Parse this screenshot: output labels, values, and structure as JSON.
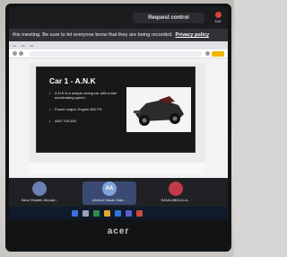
{
  "meeting": {
    "request_control_label": "Request control",
    "exit_label": "Exit",
    "recording_notice": "this meeting. Be sure to let everyone know that they are being recorded.",
    "privacy_link": "Privacy policy"
  },
  "slide": {
    "title": "Car 1 - A.N.K",
    "bullets": [
      "A.N.K is a unique racing car with a fast accelerating speed.",
      "Power output: Engine 800 PS",
      "AED 700,000"
    ]
  },
  "participants": [
    {
      "name": "Sara Ghadeir Ahmad..."
    },
    {
      "name": "Ahmed Hasan Sale...",
      "initials": "AA"
    },
    {
      "name": "SANA ABDULLA..."
    }
  ],
  "laptop_brand": "acer",
  "colors": {
    "slide_background": "#17181a",
    "meeting_bar": "#303236",
    "exit_button": "#d9443b"
  }
}
